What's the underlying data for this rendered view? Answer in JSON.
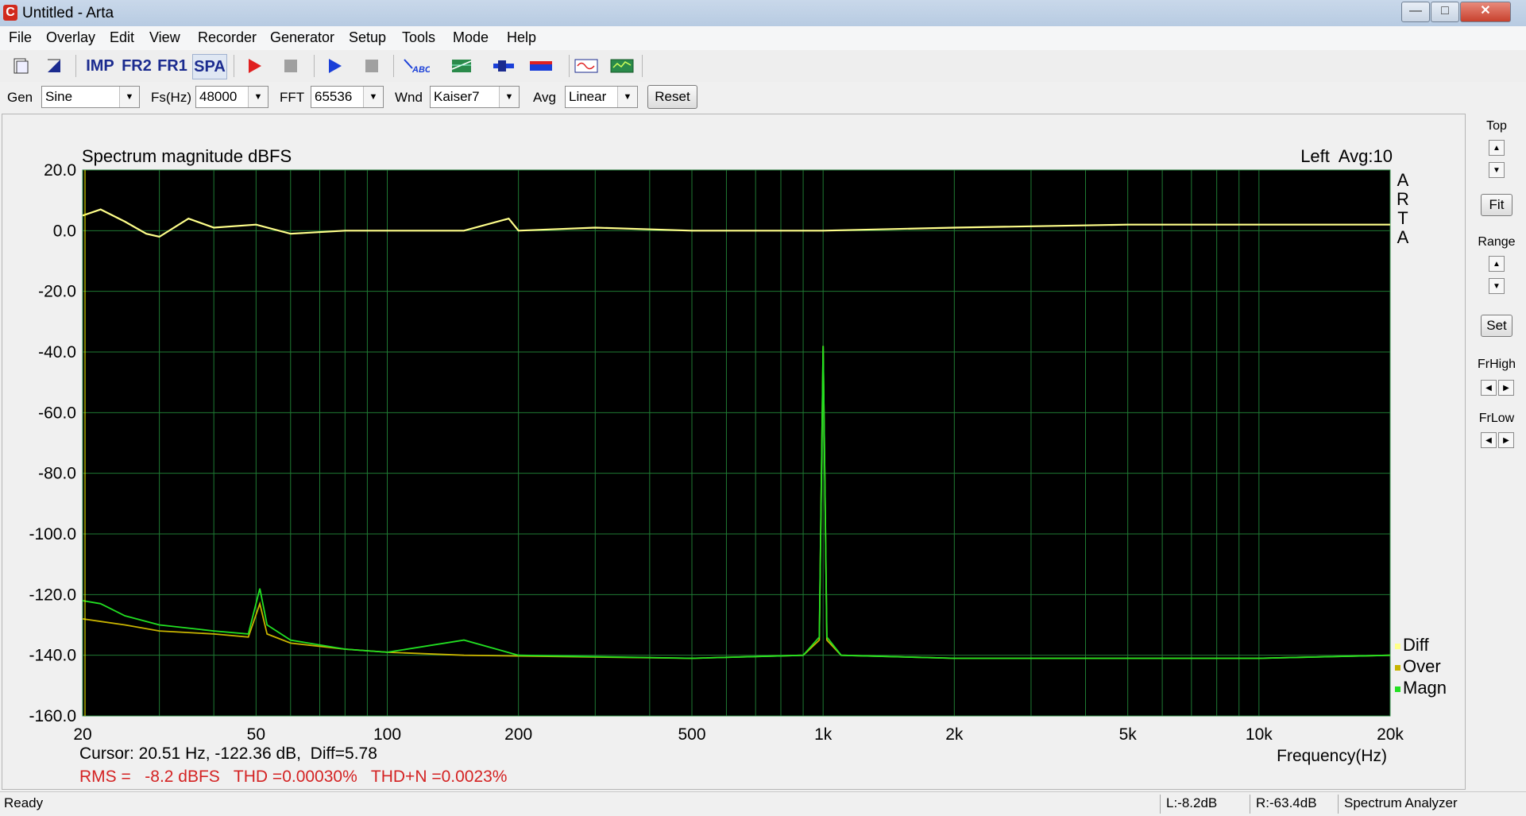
{
  "window": {
    "title": "Untitled - Arta",
    "app_icon_letter": "C",
    "minimize": "—",
    "maximize": "□",
    "close": "✕"
  },
  "menu": [
    "File",
    "Overlay",
    "Edit",
    "View",
    "Recorder",
    "Generator",
    "Setup",
    "Tools",
    "Mode",
    "Help"
  ],
  "toolbar": {
    "buttons": [
      {
        "name": "new-icon"
      },
      {
        "name": "open-icon"
      },
      {
        "name": "impulse-mode-button",
        "label": "IMP"
      },
      {
        "name": "fr2-mode-button",
        "label": "FR2"
      },
      {
        "name": "fr1-mode-button",
        "label": "FR1"
      },
      {
        "name": "spa-mode-button",
        "label": "SPA"
      },
      {
        "name": "record-icon"
      },
      {
        "name": "stop-record-icon"
      },
      {
        "name": "play-icon"
      },
      {
        "name": "stop-play-icon"
      },
      {
        "name": "abc-icon",
        "label": "ABC"
      },
      {
        "name": "chart-grid-icon"
      },
      {
        "name": "connector-icon"
      },
      {
        "name": "meter-icon"
      },
      {
        "name": "sine-icon"
      },
      {
        "name": "scope-icon"
      }
    ]
  },
  "controls": {
    "gen_label": "Gen",
    "gen_value": "Sine",
    "fs_label": "Fs(Hz)",
    "fs_value": "48000",
    "fft_label": "FFT",
    "fft_value": "65536",
    "wnd_label": "Wnd",
    "wnd_value": "Kaiser7",
    "avg_label": "Avg",
    "avg_value": "Linear",
    "reset_label": "Reset"
  },
  "chart_data": {
    "type": "line",
    "title": "Spectrum magnitude dBFS",
    "channel_info": "Left  Avg:10",
    "xlabel": "Frequency(Hz)",
    "xscale": "log",
    "xlim": [
      20,
      20000
    ],
    "ylim": [
      -160,
      20
    ],
    "x_tick_values": [
      20,
      50,
      100,
      200,
      500,
      1000,
      2000,
      5000,
      10000,
      20000
    ],
    "x_tick_labels": [
      "20",
      "50",
      "100",
      "200",
      "500",
      "1k",
      "2k",
      "5k",
      "10k",
      "20k"
    ],
    "y_tick_values": [
      20,
      0,
      -20,
      -40,
      -60,
      -80,
      -100,
      -120,
      -140,
      -160
    ],
    "y_tick_labels": [
      "20.0",
      "0.0",
      "-20.0",
      "-40.0",
      "-60.0",
      "-80.0",
      "-100.0",
      "-120.0",
      "-140.0",
      "-160.0"
    ],
    "grid": true,
    "legend": {
      "placement": "bottom-right",
      "items": [
        "Diff",
        "Over",
        "Magn"
      ]
    },
    "side_label": [
      "A",
      "R",
      "T",
      "A"
    ],
    "series": [
      {
        "name": "Diff",
        "color": "#ffff8a",
        "points": [
          [
            20,
            5
          ],
          [
            22,
            7
          ],
          [
            25,
            3
          ],
          [
            28,
            -1
          ],
          [
            30,
            -2
          ],
          [
            35,
            4
          ],
          [
            40,
            1
          ],
          [
            50,
            2
          ],
          [
            60,
            -1
          ],
          [
            80,
            0
          ],
          [
            100,
            0
          ],
          [
            150,
            0
          ],
          [
            190,
            4
          ],
          [
            200,
            0
          ],
          [
            300,
            1
          ],
          [
            500,
            0
          ],
          [
            1000,
            0
          ],
          [
            2000,
            1
          ],
          [
            5000,
            2
          ],
          [
            10000,
            2
          ],
          [
            20000,
            2
          ]
        ]
      },
      {
        "name": "Over",
        "color": "#c8b400",
        "points": [
          [
            20,
            -128
          ],
          [
            25,
            -130
          ],
          [
            30,
            -132
          ],
          [
            40,
            -133
          ],
          [
            48,
            -134
          ],
          [
            51,
            -123
          ],
          [
            53,
            -133
          ],
          [
            60,
            -136
          ],
          [
            80,
            -138
          ],
          [
            100,
            -139
          ],
          [
            150,
            -140
          ],
          [
            500,
            -141
          ],
          [
            900,
            -140
          ],
          [
            980,
            -135
          ],
          [
            1000,
            -38
          ],
          [
            1020,
            -135
          ],
          [
            1100,
            -140
          ],
          [
            2000,
            -141
          ],
          [
            5000,
            -141
          ],
          [
            10000,
            -141
          ],
          [
            20000,
            -140
          ]
        ]
      },
      {
        "name": "Magn",
        "color": "#22e022",
        "points": [
          [
            20,
            -122
          ],
          [
            22,
            -123
          ],
          [
            25,
            -127
          ],
          [
            30,
            -130
          ],
          [
            40,
            -132
          ],
          [
            48,
            -133
          ],
          [
            51,
            -118
          ],
          [
            53,
            -130
          ],
          [
            60,
            -135
          ],
          [
            80,
            -138
          ],
          [
            100,
            -139
          ],
          [
            150,
            -135
          ],
          [
            200,
            -140
          ],
          [
            500,
            -141
          ],
          [
            900,
            -140
          ],
          [
            980,
            -134
          ],
          [
            1000,
            -38
          ],
          [
            1020,
            -134
          ],
          [
            1100,
            -140
          ],
          [
            2000,
            -141
          ],
          [
            5000,
            -141
          ],
          [
            10000,
            -141
          ],
          [
            20000,
            -140
          ]
        ]
      }
    ],
    "cursor_text": "Cursor: 20.51 Hz, -122.36 dB,  Diff=5.78",
    "rms_text": "RMS =   -8.2 dBFS   THD =0.00030%   THD+N =0.0023%"
  },
  "right_panel": {
    "top": "Top",
    "fit": "Fit",
    "range": "Range",
    "set": "Set",
    "frhigh": "FrHigh",
    "frlow": "FrLow"
  },
  "status": {
    "ready": "Ready",
    "left_level": "L:-8.2dB",
    "right_level": "R:-63.4dB",
    "mode": "Spectrum Analyzer"
  },
  "colors": {
    "plot_bg": "#000000",
    "grid": "#1f7a33",
    "diff": "#ffff8a",
    "over": "#c8b400",
    "magn": "#22e022",
    "rms_text": "#d42323"
  }
}
